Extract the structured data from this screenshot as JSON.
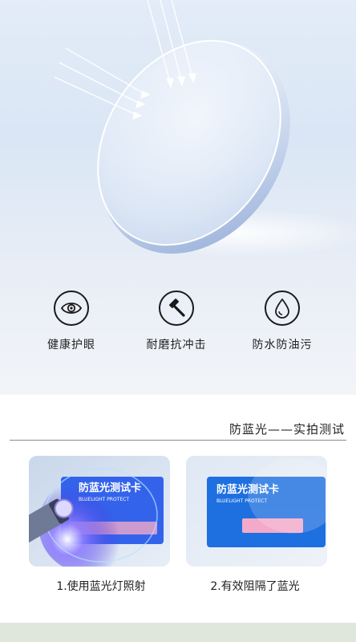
{
  "features": [
    {
      "icon": "eye-icon",
      "label": "健康护眼"
    },
    {
      "icon": "hammer-icon",
      "label": "耐磨抗冲击"
    },
    {
      "icon": "water-drop-icon",
      "label": "防水防油污"
    }
  ],
  "test_section": {
    "title": "防蓝光——实拍测试",
    "photos": [
      {
        "card_title": "防蓝光测试卡",
        "card_subtitle": "BLUELIGHT PROTECT",
        "caption": "1.使用蓝光灯照射"
      },
      {
        "card_title": "防蓝光测试卡",
        "card_subtitle": "BLUELIGHT PROTECT",
        "caption": "2.有效阻隔了蓝光"
      }
    ]
  },
  "colors": {
    "hero_bg": "#dde8f6",
    "card_blue": "#1e6fe0",
    "card_pink": "#f3a9c9",
    "blue_light": "#6b5cff",
    "footer": "#dfe6dc"
  }
}
